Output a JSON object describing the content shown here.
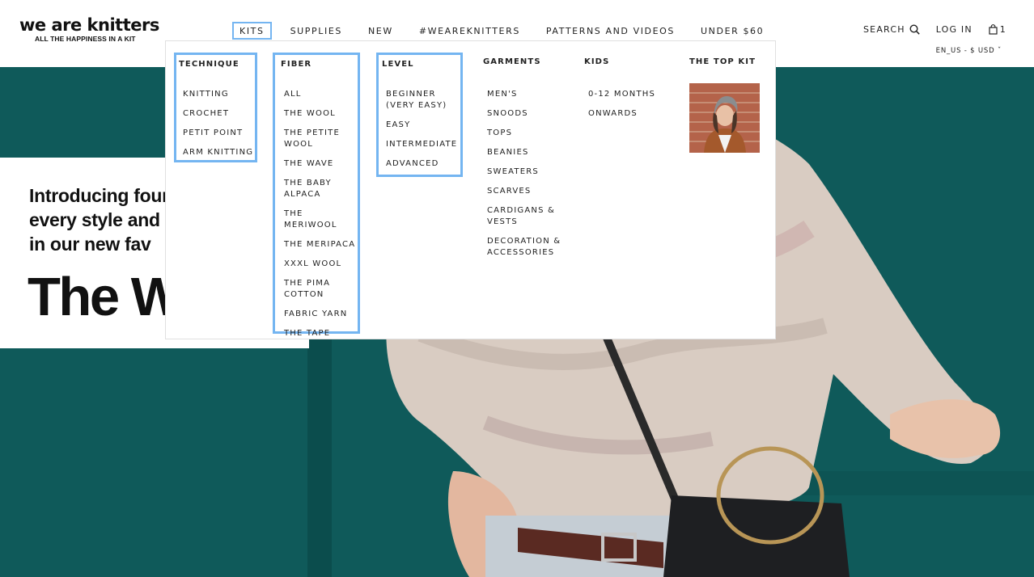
{
  "brand": {
    "name": "we are knitters",
    "tagline": "ALL THE HAPPINESS IN A KIT"
  },
  "nav": {
    "items": [
      {
        "label": "KITS"
      },
      {
        "label": "SUPPLIES"
      },
      {
        "label": "NEW"
      },
      {
        "label": "#WEAREKNITTERS"
      },
      {
        "label": "PATTERNS AND VIDEOS"
      },
      {
        "label": "UNDER $60"
      }
    ],
    "active": "KITS"
  },
  "utility": {
    "search_label": "SEARCH",
    "login_label": "LOG IN",
    "cart_count": "1",
    "locale_label": "EN_US - $ USD"
  },
  "hero": {
    "line1": "Introducing four",
    "line2": "every style and",
    "line3": "in our new fav",
    "big": "The W"
  },
  "menu": {
    "technique": {
      "title": "TECHNIQUE",
      "items": [
        "KNITTING",
        "CROCHET",
        "PETIT POINT",
        "ARM KNITTING"
      ]
    },
    "fiber": {
      "title": "FIBER",
      "items": [
        "ALL",
        "THE WOOL",
        "THE PETITE WOOL",
        "THE WAVE",
        "THE BABY ALPACA",
        "THE MERIWOOL",
        "THE MERIPACA",
        "XXXL WOOL",
        "THE PIMA COTTON",
        "FABRIC YARN",
        "THE TAPE"
      ]
    },
    "level": {
      "title": "LEVEL",
      "items": [
        "BEGINNER (VERY EASY)",
        "EASY",
        "INTERMEDIATE",
        "ADVANCED"
      ]
    },
    "garments": {
      "title": "GARMENTS",
      "items": [
        "MEN'S",
        "SNOODS",
        "TOPS",
        "BEANIES",
        "SWEATERS",
        "SCARVES",
        "CARDIGANS & VESTS",
        "DECORATION & ACCESSORIES"
      ]
    },
    "kids": {
      "title": "KIDS",
      "items": [
        "0-12 MONTHS",
        "ONWARDS"
      ]
    },
    "topkit": {
      "title": "THE TOP KIT"
    }
  },
  "colors": {
    "highlight": "#74b5f1",
    "hero_bg": "#0f5a5a",
    "text": "#222222"
  },
  "icons": [
    "search-icon",
    "cart-icon",
    "chevron-down-icon"
  ]
}
